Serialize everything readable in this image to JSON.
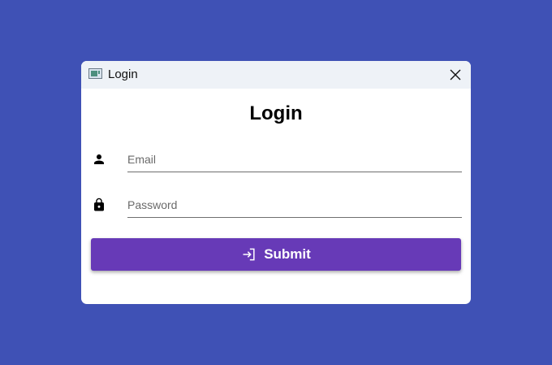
{
  "window": {
    "title": "Login",
    "icon": "app-window-icon",
    "close_icon": "close-icon"
  },
  "form": {
    "heading": "Login",
    "email": {
      "icon": "person-icon",
      "placeholder": "Email",
      "value": ""
    },
    "password": {
      "icon": "lock-icon",
      "placeholder": "Password",
      "value": ""
    },
    "submit": {
      "icon": "login-icon",
      "label": "Submit"
    }
  },
  "colors": {
    "background": "#3f51b5",
    "titlebar": "#eef2f7",
    "button": "#673ab7",
    "button_text": "#ffffff"
  }
}
